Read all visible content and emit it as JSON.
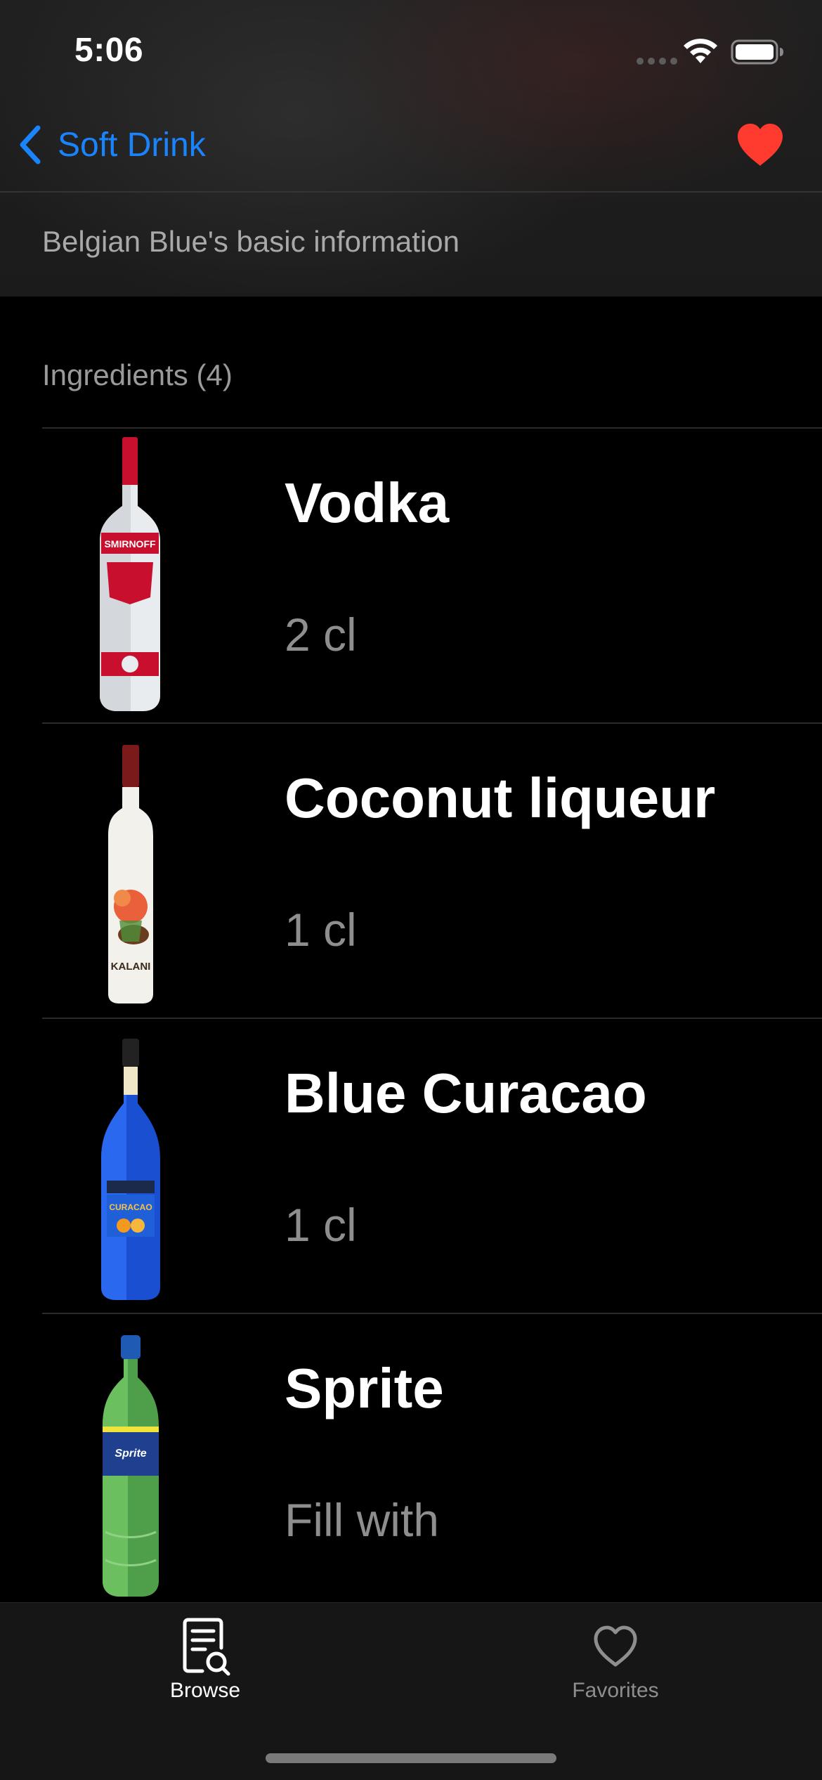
{
  "status_bar": {
    "time": "5:06"
  },
  "nav": {
    "back_label": "Soft Drink",
    "back_icon": "chevron-left-icon",
    "favorite_icon": "heart-filled-icon"
  },
  "info_banner": {
    "text": "Belgian Blue's basic information"
  },
  "ingredients": {
    "header": "Ingredients (4)",
    "items": [
      {
        "name": "Vodka",
        "amount": "2 cl",
        "bottle_label": "SMIRNOFF"
      },
      {
        "name": "Coconut liqueur",
        "amount": "1 cl",
        "bottle_label": "KALANI"
      },
      {
        "name": "Blue Curacao",
        "amount": "1 cl",
        "bottle_label": "CURACAO"
      },
      {
        "name": "Sprite",
        "amount": "Fill with",
        "bottle_label": "Sprite"
      }
    ]
  },
  "tab_bar": {
    "tabs": [
      {
        "label": "Browse",
        "icon": "browse-icon",
        "selected": true
      },
      {
        "label": "Favorites",
        "icon": "heart-outline-icon",
        "selected": false
      }
    ]
  },
  "colors": {
    "accent": "#1a84ff",
    "favorite": "#ff3b30",
    "background": "#000000",
    "secondary_text": "#8e8e8e"
  }
}
